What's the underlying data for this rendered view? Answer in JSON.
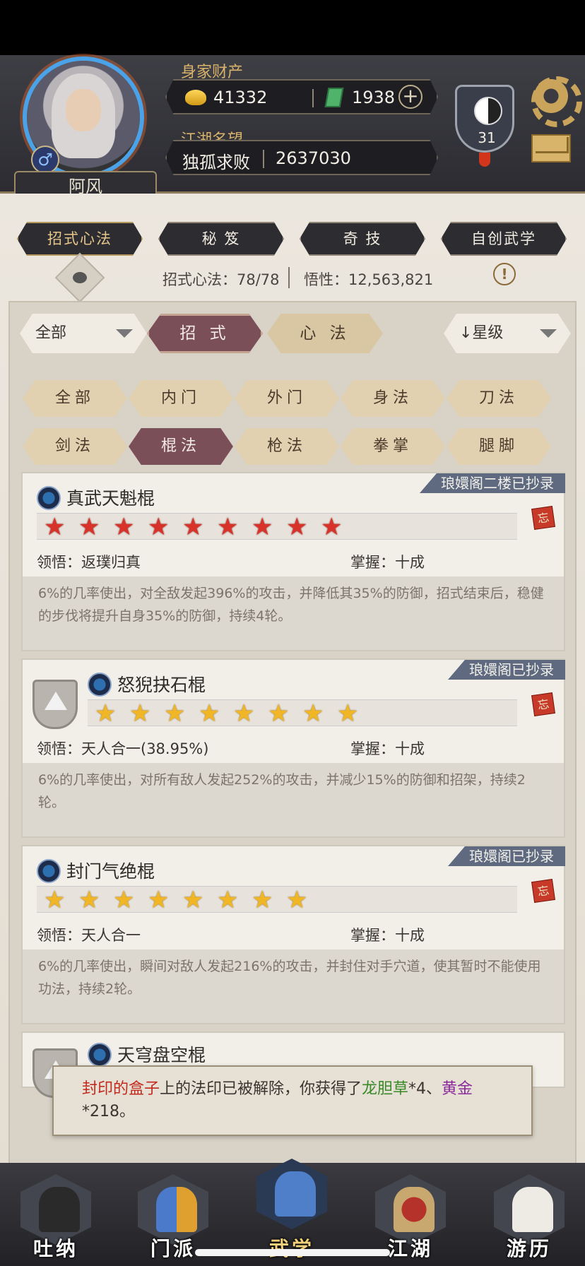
{
  "header": {
    "player_name": "阿风",
    "gender_symbol": "♂",
    "wealth_label": "身家财产",
    "gold_value": "41332",
    "jade_value": "1938",
    "plus": "+",
    "fame_label": "江湖名望",
    "fame_title": "独孤求败",
    "fame_value": "2637030",
    "rank_level": "31"
  },
  "top_tabs": [
    {
      "label": "招式心法",
      "active": true
    },
    {
      "label": "秘 笈",
      "active": false
    },
    {
      "label": "奇 技",
      "active": false
    },
    {
      "label": "自创武学",
      "active": false
    }
  ],
  "info": {
    "skills_text": "招式心法：78/78",
    "insight_text": "悟性：12,563,821",
    "alert": "!"
  },
  "filters": {
    "scope": "全部",
    "toggle_moves": "招 式",
    "toggle_methods": "心 法",
    "sort": "↓星级"
  },
  "categories": [
    {
      "label": "全部",
      "active": false
    },
    {
      "label": "内门",
      "active": false
    },
    {
      "label": "外门",
      "active": false
    },
    {
      "label": "身法",
      "active": false
    },
    {
      "label": "刀法",
      "active": false
    },
    {
      "label": "剑法",
      "active": false
    },
    {
      "label": "棍法",
      "active": true
    },
    {
      "label": "枪法",
      "active": false
    },
    {
      "label": "拳掌",
      "active": false
    },
    {
      "label": "腿脚",
      "active": false
    }
  ],
  "skills": [
    {
      "tag": "琅嬛阁二楼已抄录",
      "name": "真武天魁棍",
      "stars": 9,
      "star_color": "red",
      "insight": "领悟：返璞归真",
      "mastery": "掌握：十成",
      "desc": "6%的几率使出，对全敌发起396%的攻击，并降低其35%的防御，招式结束后，稳健的步伐将提升自身35%的防御，持续4轮。",
      "forget": "忘"
    },
    {
      "tag": "琅嬛阁已抄录",
      "name": "怒猊抉石棍",
      "stars": 8,
      "star_color": "gold",
      "insight": "领悟：天人合一(38.95%)",
      "mastery": "掌握：十成",
      "desc": "6%的几率使出，对所有敌人发起252%的攻击，并减少15%的防御和招架，持续2轮。",
      "forget": "忘"
    },
    {
      "tag": "琅嬛阁已抄录",
      "name": "封门气绝棍",
      "stars": 8,
      "star_color": "gold",
      "insight": "领悟：天人合一",
      "mastery": "掌握：十成",
      "desc": "6%的几率使出，瞬间对敌人发起216%的攻击，并封住对手穴道，使其暂时不能使用功法，持续2轮。",
      "forget": "忘"
    },
    {
      "name": "天穹盘空棍"
    }
  ],
  "toast": {
    "part1": "封印的盒子",
    "part2": "上的法印已被解除，你获得了",
    "part3": "龙胆草",
    "part4": "*4、",
    "part5": "黄金",
    "part6": "*218。"
  },
  "bottom_nav": [
    {
      "label": "吐纳",
      "active": false
    },
    {
      "label": "门派",
      "active": false
    },
    {
      "label": "武学",
      "active": true
    },
    {
      "label": "江湖",
      "active": false
    },
    {
      "label": "游历",
      "active": false
    }
  ],
  "colors": {
    "accent_active": "#7a4f57",
    "star_red": "#d8332a",
    "star_gold": "#f0b626",
    "tag_bg": "#5f6a80"
  }
}
